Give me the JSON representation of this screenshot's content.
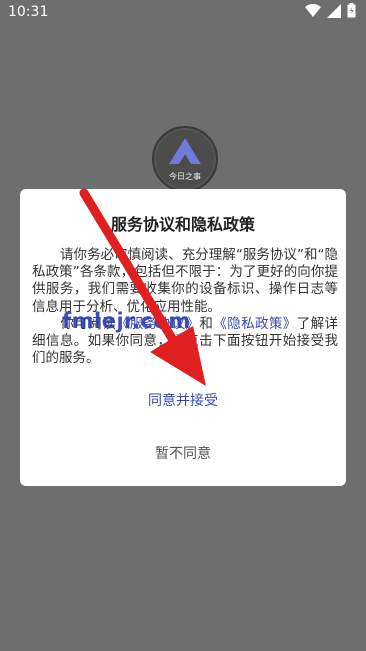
{
  "status_bar": {
    "time": "10:31"
  },
  "app": {
    "logo_text": "今日之事"
  },
  "dialog": {
    "title": "服务协议和隐私政策",
    "paragraph1": "请你务必审慎阅读、充分理解“服务协议”和“隐私政策”各条款，包括但不限于：为了更好的向你提供服务，我们需要收集你的设备标识、操作日志等信息用于分析、优化应用性能。",
    "paragraph2_prefix": "你可阅读",
    "service_agreement_link": "《服务协议》",
    "and": "和",
    "privacy_policy_link": "《隐私政策》",
    "paragraph2_suffix": "了解详细信息。如果你同意，请点击下面按钮开始接受我们的服务。",
    "agree_label": "同意并接受",
    "disagree_label": "暂不同意"
  },
  "watermark": {
    "text": "fmlejr.com"
  },
  "colors": {
    "link": "#3949ab",
    "overlay": "#6e6e6e",
    "arrow": "#e02020"
  }
}
